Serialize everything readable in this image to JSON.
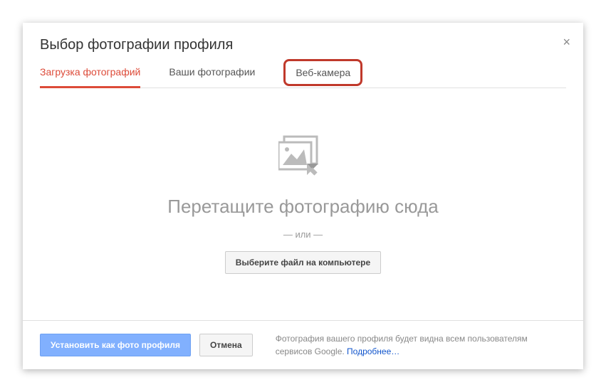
{
  "dialog": {
    "title": "Выбор фотографии профиля",
    "close_symbol": "×"
  },
  "tabs": {
    "upload": "Загрузка фотографий",
    "your_photos": "Ваши фотографии",
    "webcam": "Веб-камера"
  },
  "body": {
    "drop_text": "Перетащите фотографию сюда",
    "or_text": "— или —",
    "choose_button": "Выберите файл на компьютере"
  },
  "footer": {
    "primary_button": "Установить как фото профиля",
    "cancel_button": "Отмена",
    "disclaimer_text": "Фотография вашего профиля будет видна всем пользователям сервисов Google. ",
    "learn_more": "Подробнее…"
  }
}
